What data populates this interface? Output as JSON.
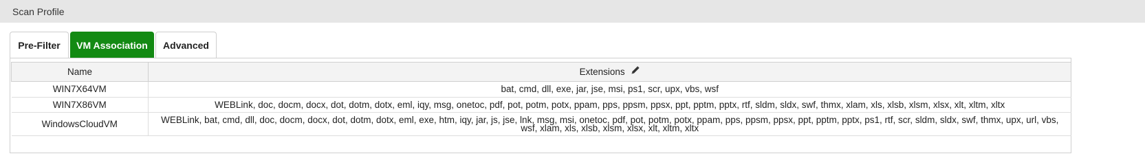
{
  "header": {
    "title": "Scan Profile"
  },
  "tabs": [
    {
      "label": "Pre-Filter",
      "active": false
    },
    {
      "label": "VM Association",
      "active": true
    },
    {
      "label": "Advanced",
      "active": false
    }
  ],
  "table": {
    "columns": {
      "name": "Name",
      "extensions": "Extensions"
    },
    "edit_icon": "pencil-icon",
    "rows": [
      {
        "name": "WIN7X64VM",
        "extensions": "bat, cmd, dll, exe, jar, jse, msi, ps1, scr, upx, vbs, wsf"
      },
      {
        "name": "WIN7X86VM",
        "extensions": "WEBLink, doc, docm, docx, dot, dotm, dotx, eml, iqy, msg, onetoc, pdf, pot, potm, potx, ppam, pps, ppsm, ppsx, ppt, pptm, pptx, rtf, sldm, sldx, swf, thmx, xlam, xls, xlsb, xlsm, xlsx, xlt, xltm, xltx"
      },
      {
        "name": "WindowsCloudVM",
        "extensions": "WEBLink, bat, cmd, dll, doc, docm, docx, dot, dotm, dotx, eml, exe, htm, iqy, jar, js, jse, lnk, msg, msi, onetoc, pdf, pot, potm, potx, ppam, pps, ppsm, ppsx, ppt, pptm, pptx, ps1, rtf, scr, sldm, sldx, swf, thmx, upx, url, vbs, wsf, xlam, xls, xlsb, xlsm, xlsx, xlt, xltm, xltx"
      }
    ]
  },
  "colors": {
    "active_tab": "#138a13",
    "header_bg": "#e6e6e6",
    "table_header_bg": "#f3f3f3"
  }
}
